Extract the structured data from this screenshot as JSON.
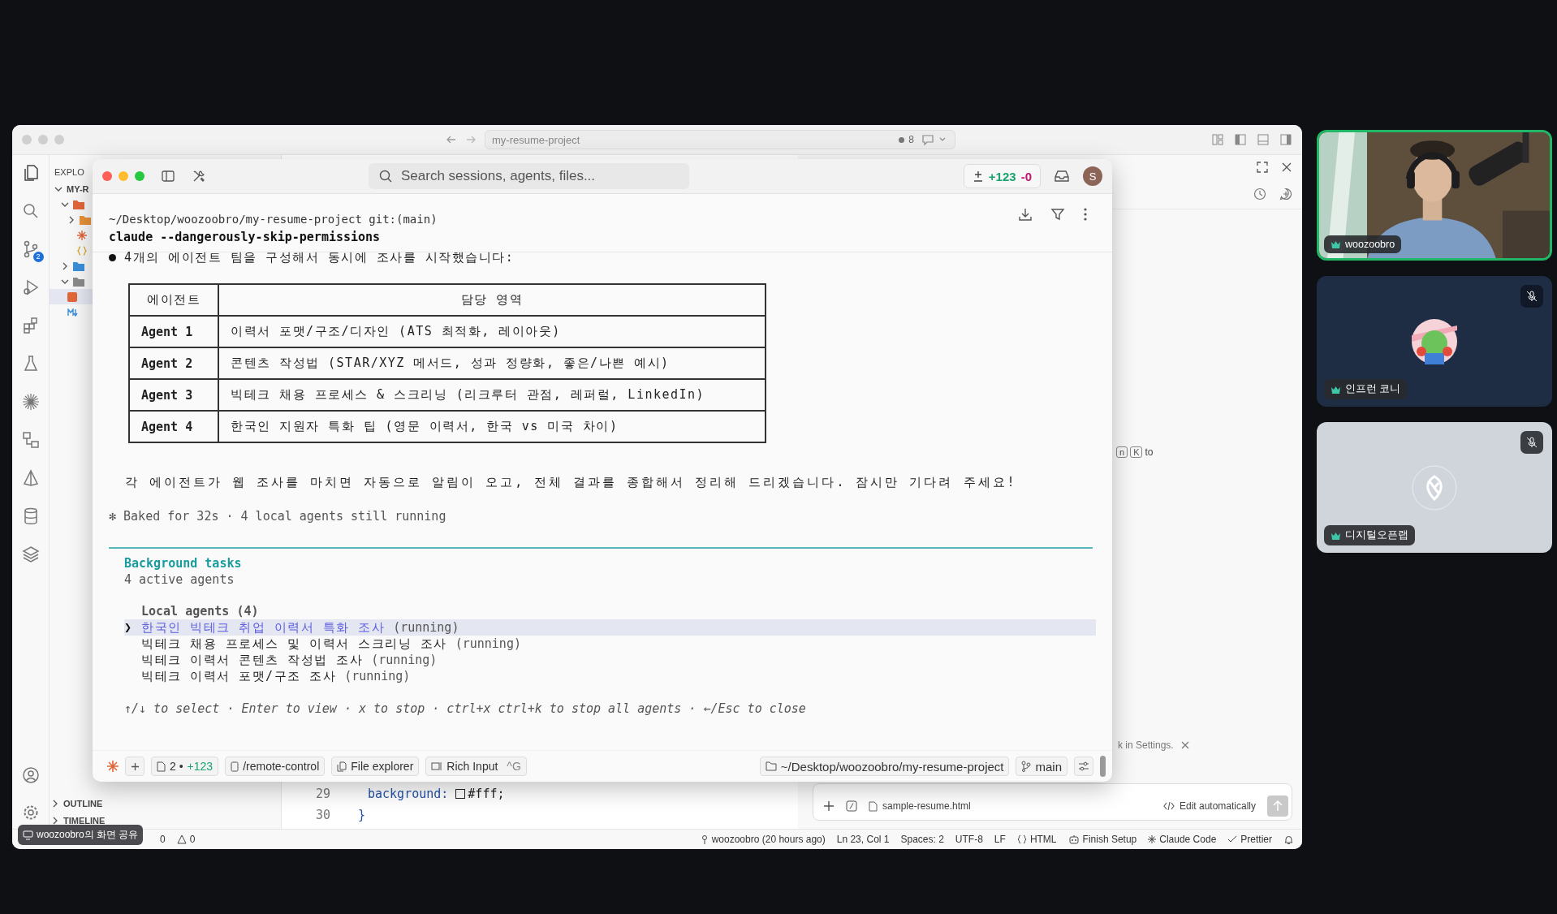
{
  "vscode": {
    "title_search": "my-resume-project",
    "sync_count": "8",
    "scm_badge": "2",
    "explorer_title": "EXPLO",
    "explorer_root": "MY-R",
    "sections": [
      "OUTLINE",
      "TIMELINE"
    ],
    "editor_lines": [
      {
        "number": "29",
        "property": "background:",
        "value": "#fff;"
      },
      {
        "number": "30",
        "value": "}"
      }
    ],
    "chat": {
      "shortcut_keys": [
        "n",
        "K"
      ],
      "shortcut_text": "to",
      "notice": "k in Settings.",
      "attachment": "sample-resume.html",
      "mode": "Edit automatically"
    },
    "status_left": [
      {
        "kind": "text",
        "text": "0"
      },
      {
        "kind": "warning",
        "text": "0"
      }
    ],
    "status_right": [
      {
        "kind": "author",
        "text": "woozoobro (20 hours ago)"
      },
      {
        "kind": "text",
        "text": "Ln 23, Col 1"
      },
      {
        "kind": "text",
        "text": "Spaces: 2"
      },
      {
        "kind": "text",
        "text": "UTF-8"
      },
      {
        "kind": "text",
        "text": "LF"
      },
      {
        "kind": "language",
        "text": "HTML"
      },
      {
        "kind": "setup",
        "text": "Finish Setup"
      },
      {
        "kind": "claude",
        "text": "Claude Code"
      },
      {
        "kind": "prettier",
        "text": "Prettier"
      },
      {
        "kind": "bell"
      }
    ]
  },
  "claude_app": {
    "search_placeholder": "Search sessions, agents, files...",
    "diff_added": "+123",
    "diff_removed": "-0",
    "avatar_initial": "S",
    "cwd": "~/Desktop/woozoobro/my-resume-project git:(main)",
    "command": "claude --dangerously-skip-permissions",
    "message": "4개의 에이전트 팀을 구성해서 동시에 조사를 시작했습니다:",
    "table": {
      "columns": [
        "에이전트",
        "담당 영역"
      ],
      "rows": [
        [
          "Agent 1",
          "이력서 포맷/구조/디자인 (ATS 최적화, 레이아웃)"
        ],
        [
          "Agent 2",
          "콘텐츠 작성법 (STAR/XYZ 메서드, 성과 정량화, 좋은/나쁜 예시)"
        ],
        [
          "Agent 3",
          "빅테크 채용 프로세스 & 스크리닝 (리크루터 관점, 레퍼럴, LinkedIn)"
        ],
        [
          "Agent 4",
          "한국인 지원자 특화 팁 (영문 이력서, 한국 vs 미국 차이)"
        ]
      ]
    },
    "summary": "각 에이전트가 웹 조사를 마치면 자동으로 알림이 오고, 전체 결과를 종합해서 정리해 드리겠습니다. 잠시만 기다려 주세요!",
    "status_line": "✻ Baked for 32s · 4 local agents still running",
    "tasks": {
      "title": "Background tasks",
      "subtitle": "4 active agents",
      "group": "Local agents (4)",
      "marker": "❯",
      "items": [
        {
          "name": "한국인 빅테크 취업 이력서 특화 조사",
          "status": "(running)",
          "selected": true
        },
        {
          "name": "빅테크 채용 프로세스 및 이력서 스크리닝 조사",
          "status": "(running)",
          "selected": false
        },
        {
          "name": "빅테크 이력서 콘텐츠 작성법 조사",
          "status": "(running)",
          "selected": false
        },
        {
          "name": "빅테크 이력서 포맷/구조 조사",
          "status": "(running)",
          "selected": false
        }
      ],
      "hint": "↑/↓ to select · Enter to view · x to stop · ctrl+x ctrl+k to stop all agents · ←/Esc to close"
    },
    "footer_left": [
      {
        "kind": "changes",
        "count": "2",
        "separator": "•",
        "added": "+123"
      },
      {
        "kind": "remote",
        "label": "/remote-control"
      },
      {
        "kind": "files",
        "label": "File explorer"
      },
      {
        "kind": "input",
        "label": "Rich Input",
        "shortcut": "^G"
      }
    ],
    "footer_right": [
      {
        "kind": "folder",
        "label": "~/Desktop/woozoobro/my-resume-project"
      },
      {
        "kind": "branch",
        "label": "main"
      },
      {
        "kind": "settings"
      }
    ]
  },
  "participants": [
    {
      "name": "woozoobro",
      "kind": "camera",
      "speaking": true,
      "muted": false
    },
    {
      "name": "인프런 코니",
      "kind": "avatar",
      "speaking": false,
      "muted": true
    },
    {
      "name": "디지털오픈랩",
      "kind": "placeholder",
      "speaking": false,
      "muted": true
    }
  ],
  "screen_share_label": "woozoobro의 화면 공유"
}
